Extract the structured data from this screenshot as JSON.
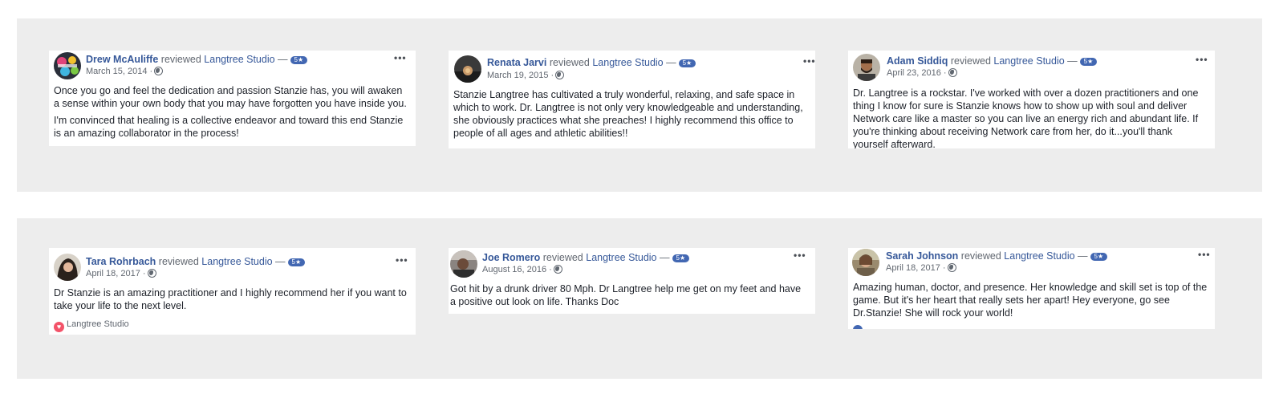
{
  "reviews": [
    {
      "author": "Drew McAuliffe",
      "action": "reviewed",
      "page": "Langtree Studio",
      "dash": "—",
      "rating_badge": "5★",
      "date": "March 15, 2014 ·",
      "paragraphs": [
        "Once you go and feel the dedication and passion Stanzie has, you will awaken a sense within your own body that you may have forgotten you have inside you.",
        "I'm convinced that healing is a collective endeavor and toward this end Stanzie is an amazing collaborator in the process!"
      ]
    },
    {
      "author": "Renata Jarvi",
      "action": "reviewed",
      "page": "Langtree Studio",
      "dash": "—",
      "rating_badge": "5★",
      "date": "March 19, 2015 ·",
      "paragraphs": [
        "Stanzie Langtree has cultivated a truly wonderful, relaxing, and safe space in which to work. Dr. Langtree is not only very knowledgeable and understanding, she obviously practices what she preaches! I highly recommend this office to people of all ages and athletic abilities!!"
      ]
    },
    {
      "author": "Adam Siddiq",
      "action": "reviewed",
      "page": "Langtree Studio",
      "dash": "—",
      "rating_badge": "5★",
      "date": "April 23, 2016 ·",
      "paragraphs": [
        "Dr. Langtree is a rockstar. I've worked with over a dozen practitioners and one thing I know for sure is Stanzie knows how to show up with soul and deliver Network care like a master so you can live an energy rich and abundant life. If you're thinking about receiving Network care from her, do it...you'll thank yourself afterward."
      ]
    },
    {
      "author": "Tara Rohrbach",
      "action": "reviewed",
      "page": "Langtree Studio",
      "dash": "—",
      "rating_badge": "5★",
      "date": "April 18, 2017 ·",
      "paragraphs": [
        "Dr Stanzie is an amazing practitioner and I highly recommend her if you want to take your life to the next level."
      ],
      "page_tag": "Langtree Studio"
    },
    {
      "author": "Joe Romero",
      "action": "reviewed",
      "page": "Langtree Studio",
      "dash": "—",
      "rating_badge": "5★",
      "date": "August 16, 2016 ·",
      "paragraphs": [
        "Got hit by a drunk driver 80 Mph. Dr Langtree help me get on my feet and have a positive out look on life. Thanks Doc"
      ]
    },
    {
      "author": "Sarah Johnson",
      "action": "reviewed",
      "page": "Langtree Studio",
      "dash": "—",
      "rating_badge": "5★",
      "date": "April 18, 2017 ·",
      "paragraphs": [
        "Amazing human, doctor, and presence. Her knowledge and skill set is top of the game. But it's her heart that really sets her apart! Hey everyone, go see Dr.Stanzie! She will rock your world!"
      ]
    }
  ],
  "more_glyph": "•••",
  "colors": {
    "link": "#365899",
    "badge": "#4267b2",
    "band": "#ededed",
    "heart": "#f35369"
  }
}
